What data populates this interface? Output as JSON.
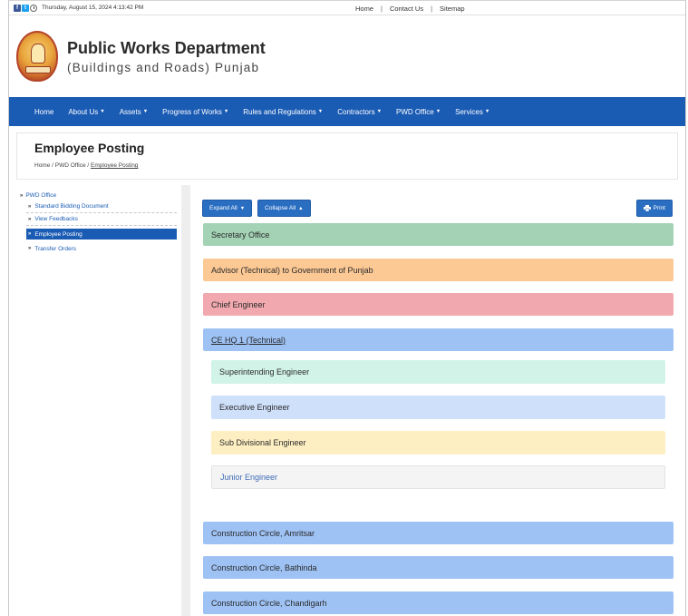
{
  "topbar": {
    "datetime": "Thursday, August 15, 2024 4:13:42 PM",
    "links": [
      "Home",
      "Contact Us",
      "Sitemap"
    ],
    "separator": "|"
  },
  "header": {
    "title": "Public Works Department",
    "subtitle": "(Buildings and Roads) Punjab"
  },
  "nav": {
    "items": [
      {
        "label": "Home",
        "dropdown": false
      },
      {
        "label": "About Us",
        "dropdown": true
      },
      {
        "label": "Assets",
        "dropdown": true
      },
      {
        "label": "Progress of Works",
        "dropdown": true
      },
      {
        "label": "Rules and Regulations",
        "dropdown": true
      },
      {
        "label": "Contractors",
        "dropdown": true
      },
      {
        "label": "PWD Office",
        "dropdown": true
      },
      {
        "label": "Services",
        "dropdown": true
      }
    ]
  },
  "page": {
    "title": "Employee Posting",
    "breadcrumb": {
      "home": "Home",
      "sep": " / ",
      "parent": "PWD Office",
      "current": "Employee Posting"
    }
  },
  "sidebar": {
    "root": "PWD Office",
    "items": [
      "Standard Bidding Document",
      "View Feedbacks",
      "Employee Posting",
      "Transfer Orders"
    ],
    "active_index": 2
  },
  "toolbar": {
    "expand": "Expand All",
    "collapse": "Collapse All",
    "print": "Print"
  },
  "accordion": [
    {
      "label": "Secretary Office",
      "color": "#a3d2b5"
    },
    {
      "label": "Advisor (Technical) to Government of Punjab",
      "color": "#fcc995"
    },
    {
      "label": "Chief Engineer",
      "color": "#f1a9af"
    },
    {
      "label": "CE HQ 1 (Technical)",
      "color": "#9ec2f4",
      "expanded": true,
      "children": [
        {
          "label": "Superintending Engineer",
          "color": "#d2f3e7"
        },
        {
          "label": "Executive Engineer",
          "color": "#cfe0fb"
        },
        {
          "label": "Sub Divisional Engineer",
          "color": "#fdefc2"
        },
        {
          "label": "Junior Engineer",
          "color": "#f4f4f4"
        }
      ]
    },
    {
      "label": "Construction Circle, Amritsar",
      "color": "#9ec2f4"
    },
    {
      "label": "Construction Circle, Bathinda",
      "color": "#9ec2f4"
    },
    {
      "label": "Construction Circle, Chandigarh",
      "color": "#9ec2f4"
    }
  ],
  "colors": {
    "nav_blue": "#1a5bb4",
    "button_blue": "#2a6ec2"
  },
  "icons": {
    "social": [
      "facebook-icon",
      "twitter-icon",
      "clock-icon"
    ],
    "print": "printer-icon",
    "bullet": "double-chevron-right-icon"
  }
}
